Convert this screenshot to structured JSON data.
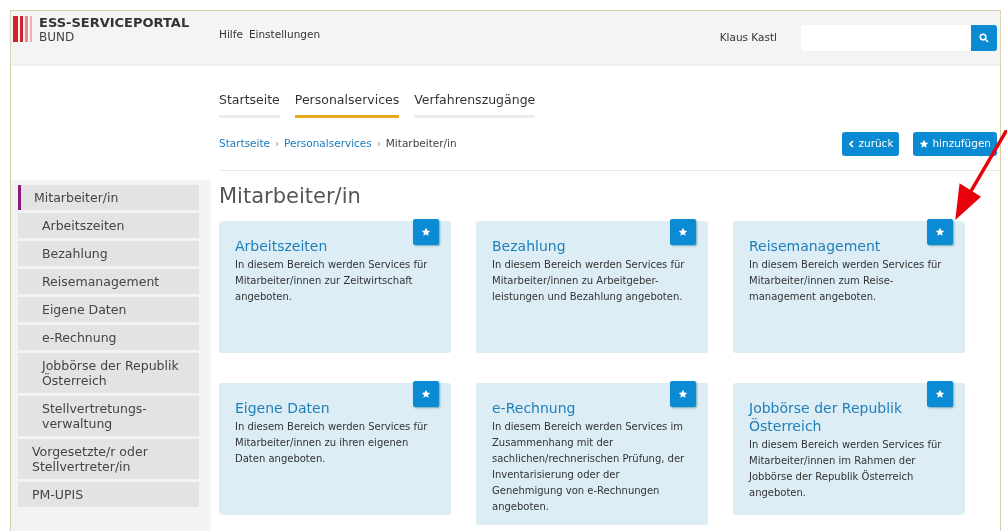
{
  "header": {
    "logo_title": "ESS-SERVICEPORTAL",
    "logo_subtitle": "BUND",
    "links": [
      "Hilfe",
      "Einstellungen"
    ],
    "user": "Klaus Kastl"
  },
  "tabs": [
    {
      "label": "Startseite",
      "selected": false
    },
    {
      "label": "Personalservices",
      "selected": true
    },
    {
      "label": "Verfahrenszugänge",
      "selected": false
    }
  ],
  "breadcrumb": [
    "Startseite",
    "Personalservices",
    "Mitarbeiter/in"
  ],
  "buttons": [
    {
      "kind": "back",
      "label": "zurück"
    },
    {
      "kind": "add",
      "label": "hinzufügen"
    }
  ],
  "sidebar": {
    "items": [
      {
        "label": "Mitarbeiter/in",
        "selected": true,
        "children": [
          {
            "label": "Arbeitszeiten",
            "selected": false
          },
          {
            "label": "Bezahlung",
            "selected": false
          },
          {
            "label": "Reisemanagement",
            "selected": false
          },
          {
            "label": "Eigene Daten",
            "selected": false
          },
          {
            "label": "e-Rechnung",
            "selected": false
          },
          {
            "label": "Jobbörse der Republik\nÖsterreich",
            "selected": false
          },
          {
            "label": "Stellvertretungs-\nverwaltung",
            "selected": false
          }
        ]
      },
      {
        "label": "Vorgesetzte/r oder\nStellvertreter/in",
        "selected": false
      },
      {
        "label": "PM-UPIS",
        "selected": false
      }
    ]
  },
  "page_title": "Mitarbeiter/in",
  "cards": [
    {
      "title": "Arbeitszeiten",
      "text": "In diesem Bereich werden Services für\nMitarbeiter/innen zur Zeitwirtschaft\nangeboten."
    },
    {
      "title": "Bezahlung",
      "text": "In diesem Bereich werden Services für\nMitarbeiter/innen zu Arbeitgeber-\nleistungen und Bezahlung angeboten."
    },
    {
      "title": "Reisemanagement",
      "text": "In diesem Bereich werden Services für\nMitarbeiter/innen zum Reise-\nmanagement angeboten."
    },
    {
      "title": "Eigene Daten",
      "text": "In diesem Bereich werden Services für\nMitarbeiter/innen zu ihren eigenen\nDaten angeboten."
    },
    {
      "title": "e-Rechnung",
      "text": "In diesem Bereich werden Services im\nZusammenhang mit der\nsachlichen/rechnerischen Prüfung, der\nInventarisierung oder der\nGenehmigung von e-Rechnungen\nangeboten."
    },
    {
      "title": "Jobbörse der Republik\nÖsterreich",
      "text": "In diesem Bereich werden Services für\nMitarbeiter/innen im Rahmen der\nJobbörse der Republik Österreich\nangeboten."
    }
  ]
}
